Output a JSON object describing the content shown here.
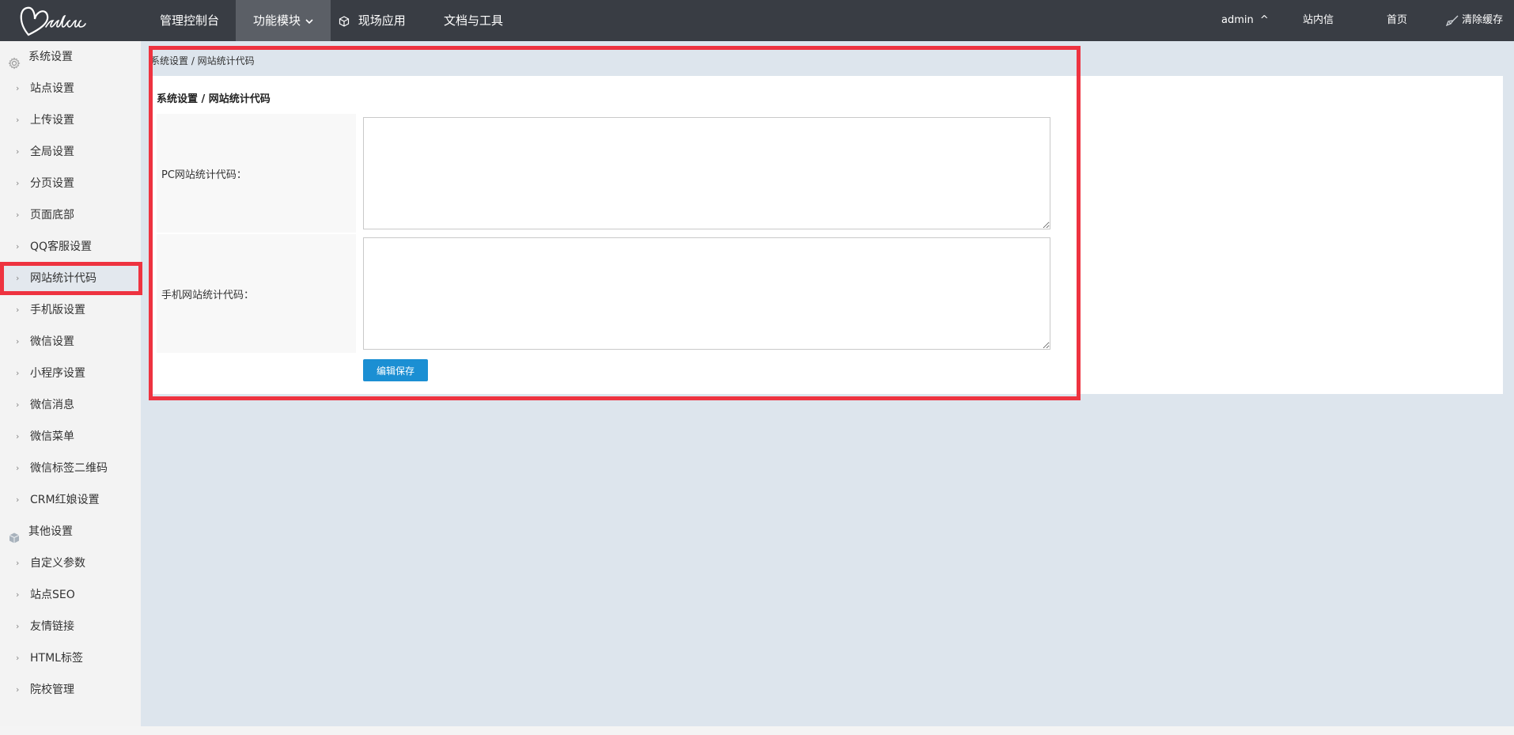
{
  "app": {
    "logo_text": "Melove",
    "colors": {
      "topbar": "#393d44",
      "accent": "#1b8fd3",
      "highlight": "#ee3340"
    }
  },
  "topnav": {
    "items": [
      {
        "label": "管理控制台"
      },
      {
        "label": "功能模块",
        "active": true
      },
      {
        "label": "现场应用",
        "icon": "cube-icon"
      },
      {
        "label": "文档与工具"
      }
    ],
    "right": {
      "user": "admin",
      "user_caret": "^",
      "messages": "站内信",
      "home": "首页",
      "clear_cache": "清除缓存"
    }
  },
  "sidebar": {
    "sections": [
      {
        "label": "系统设置",
        "icon": "gear-icon",
        "items": [
          {
            "label": "站点设置"
          },
          {
            "label": "上传设置"
          },
          {
            "label": "全局设置"
          },
          {
            "label": "分页设置"
          },
          {
            "label": "页面底部"
          },
          {
            "label": "QQ客服设置"
          },
          {
            "label": "网站统计代码",
            "active": true
          },
          {
            "label": "手机版设置"
          },
          {
            "label": "微信设置"
          },
          {
            "label": "小程序设置"
          },
          {
            "label": "微信消息"
          },
          {
            "label": "微信菜单"
          },
          {
            "label": "微信标签二维码"
          },
          {
            "label": "CRM红娘设置"
          }
        ]
      },
      {
        "label": "其他设置",
        "icon": "box-icon",
        "items": [
          {
            "label": "自定义参数"
          },
          {
            "label": "站点SEO"
          },
          {
            "label": "友情链接"
          },
          {
            "label": "HTML标签"
          },
          {
            "label": "院校管理"
          }
        ]
      }
    ]
  },
  "main": {
    "breadcrumb": "系统设置 / 网站统计代码",
    "panel_title": "系统设置 / 网站统计代码",
    "fields": [
      {
        "label": "PC网站统计代码：",
        "value": ""
      },
      {
        "label": "手机网站统计代码：",
        "value": ""
      }
    ],
    "save_label": "编辑保存"
  }
}
